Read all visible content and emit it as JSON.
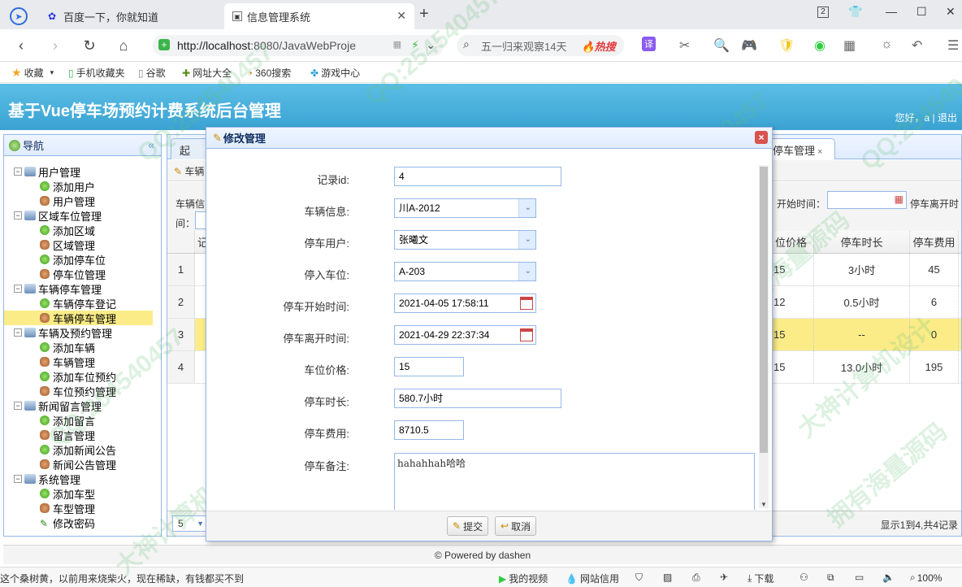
{
  "browser": {
    "tabs": [
      {
        "label": "百度一下，你就知道",
        "icon": "baidu-paw-icon"
      },
      {
        "label": "信息管理系统",
        "icon": "page-icon"
      }
    ],
    "new_tab": "+",
    "url_host": "http://localhost",
    "url_rest": ":8080/JavaWebProje",
    "search_text": "五一归来观察14天",
    "search_hot": "热搜",
    "translate_label": "译",
    "tab_counter": "2",
    "bookmarks": [
      {
        "label": "收藏",
        "icon": "star-icon"
      },
      {
        "label": "手机收藏夹",
        "icon": "phone-icon"
      },
      {
        "label": "谷歌",
        "icon": "page-icon"
      },
      {
        "label": "网址大全",
        "icon": "globe-icon"
      },
      {
        "label": "360搜索",
        "icon": "search-360-icon"
      },
      {
        "label": "游戏中心",
        "icon": "game-icon"
      }
    ]
  },
  "app": {
    "title": "基于Vue停车场预约计费系统后台管理",
    "welcome": "您好，a | 退出"
  },
  "sidebar": {
    "title": "导航",
    "groups": [
      {
        "label": "用户管理",
        "items": [
          {
            "label": "添加用户",
            "type": "add"
          },
          {
            "label": "用户管理",
            "type": "mgr"
          }
        ]
      },
      {
        "label": "区域车位管理",
        "items": [
          {
            "label": "添加区域",
            "type": "add"
          },
          {
            "label": "区域管理",
            "type": "mgr"
          },
          {
            "label": "添加停车位",
            "type": "add"
          },
          {
            "label": "停车位管理",
            "type": "mgr"
          }
        ]
      },
      {
        "label": "车辆停车管理",
        "items": [
          {
            "label": "车辆停车登记",
            "type": "add"
          },
          {
            "label": "车辆停车管理",
            "type": "mgr",
            "selected": true
          }
        ]
      },
      {
        "label": "车辆及预约管理",
        "items": [
          {
            "label": "添加车辆",
            "type": "add"
          },
          {
            "label": "车辆管理",
            "type": "mgr"
          },
          {
            "label": "添加车位预约",
            "type": "add"
          },
          {
            "label": "车位预约管理",
            "type": "mgr"
          }
        ]
      },
      {
        "label": "新闻留言管理",
        "items": [
          {
            "label": "添加留言",
            "type": "add"
          },
          {
            "label": "留言管理",
            "type": "mgr"
          },
          {
            "label": "添加新闻公告",
            "type": "add"
          },
          {
            "label": "新闻公告管理",
            "type": "mgr"
          }
        ]
      },
      {
        "label": "系统管理",
        "items": [
          {
            "label": "添加车型",
            "type": "add"
          },
          {
            "label": "车型管理",
            "type": "mgr"
          },
          {
            "label": "修改密码",
            "type": "pwd"
          }
        ]
      }
    ]
  },
  "main": {
    "tabs": [
      "起",
      "停车管理"
    ],
    "toolbar_btn": "车辆",
    "filter": {
      "label1": "车辆信",
      "label2": "间：",
      "label3": "开始时间：",
      "label4": "停车离开时"
    },
    "columns": [
      "记",
      "位价格",
      "停车时长",
      "停车费用"
    ],
    "rows": [
      {
        "num": "1",
        "price": "15",
        "duration": "3小时",
        "fee": "45"
      },
      {
        "num": "2",
        "price": "12",
        "duration": "0.5小时",
        "fee": "6"
      },
      {
        "num": "3",
        "price": "15",
        "duration": "--",
        "fee": "0"
      },
      {
        "num": "4",
        "price": "15",
        "duration": "13.0小时",
        "fee": "195"
      }
    ],
    "page_size": "5",
    "pager_info": "显示1到4,共4记录"
  },
  "modal": {
    "title": "修改管理",
    "fields": {
      "record_id": {
        "label": "记录id:",
        "value": "4"
      },
      "vehicle": {
        "label": "车辆信息:",
        "value": "川A-2012"
      },
      "user": {
        "label": "停车用户:",
        "value": "张曦文"
      },
      "space": {
        "label": "停入车位:",
        "value": "A-203"
      },
      "start_time": {
        "label": "停车开始时间:",
        "value": "2021-04-05 17:58:11"
      },
      "end_time": {
        "label": "停车离开时间:",
        "value": "2021-04-29 22:37:34"
      },
      "price": {
        "label": "车位价格:",
        "value": "15"
      },
      "duration": {
        "label": "停车时长:",
        "value": "580.7小时"
      },
      "fee": {
        "label": "停车费用:",
        "value": "8710.5"
      },
      "note": {
        "label": "停车备注:",
        "value": "hahahhah哈哈"
      }
    },
    "submit_label": "提交",
    "cancel_label": "取消"
  },
  "footer": "© Powered by dashen",
  "statusbar": {
    "news": "这个桑树黄，以前用来烧柴火，现在稀缺，有钱都买不到",
    "video": "我的视频",
    "trust": "网站信用",
    "download": "下载",
    "zoom": "100%"
  },
  "watermarks": [
    "QQ:254540457",
    "拥有海量源码",
    "大神计算机设计"
  ]
}
